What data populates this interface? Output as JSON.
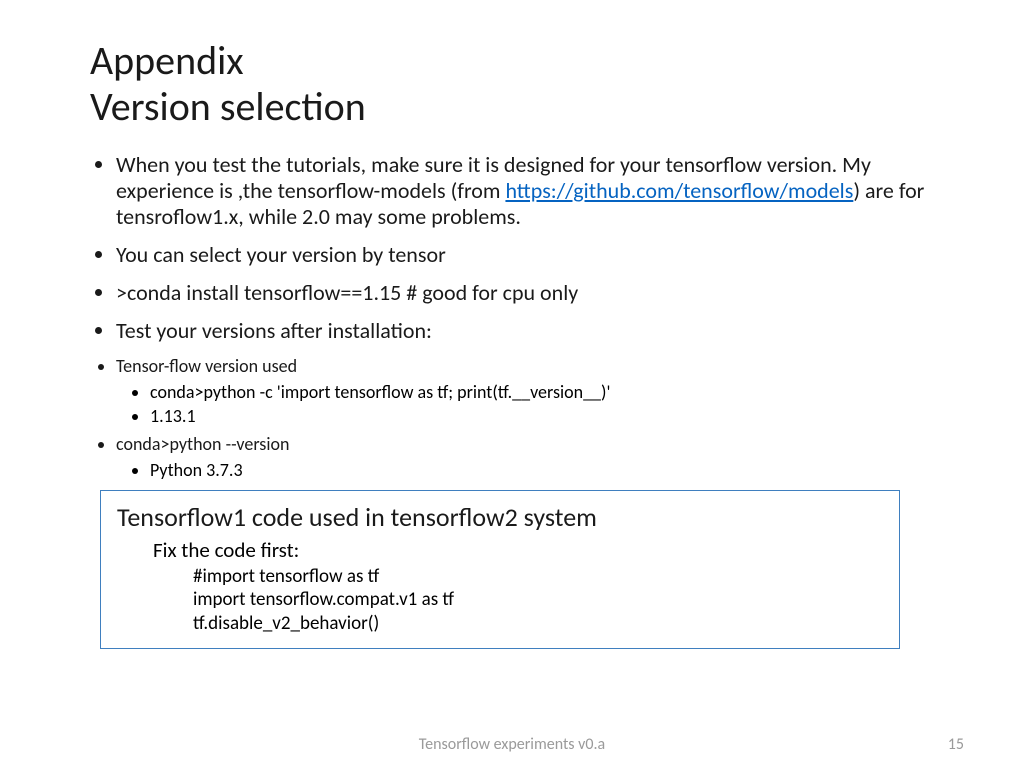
{
  "title": {
    "line1": "Appendix",
    "line2": "Version selection"
  },
  "bullets": {
    "b1_pre": "When you test the tutorials, make sure it is designed for your tensorflow version. My experience is ,the tensorflow-models (from ",
    "b1_link": "https://github.com/tensorflow/models",
    "b1_post": ") are for tensroflow1.x, while 2.0 may some problems.",
    "b2": "You can select your version by tensor",
    "b3": ">conda install tensorflow==1.15 # good for cpu only",
    "b4": "Test your versions after installation:",
    "b5": "Tensor-flow version used",
    "b5_sub1": "conda>python -c 'import tensorflow as tf; print(tf.__version__)'",
    "b5_sub2": "1.13.1",
    "b6": "conda>python  --version",
    "b6_sub1": "Python 3.7.3"
  },
  "box": {
    "title": "Tensorflow1 code used in tensorflow2 system",
    "sub": "Fix the code first:",
    "code1": "#import tensorflow as tf",
    "code2": "import tensorflow.compat.v1 as tf",
    "code3": "tf.disable_v2_behavior()"
  },
  "footer": "Tensorflow experiments v0.a",
  "page": "15"
}
